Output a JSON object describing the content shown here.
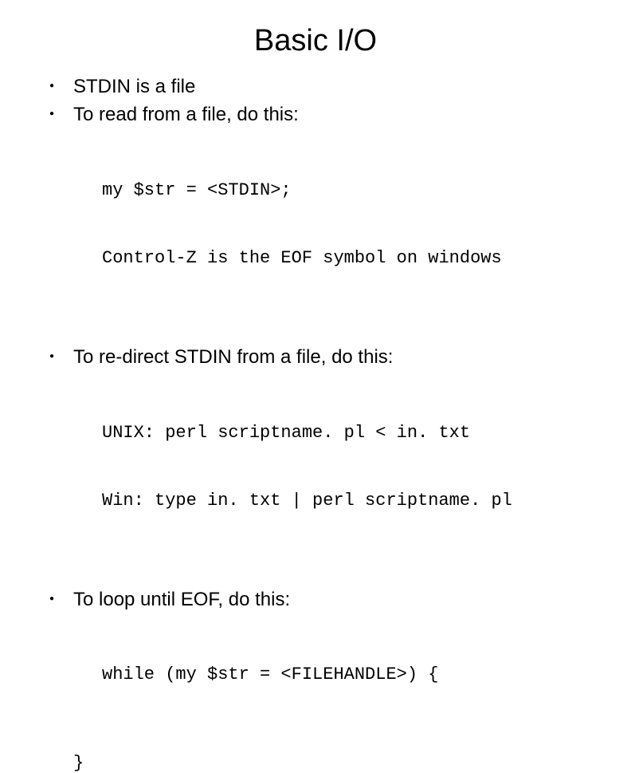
{
  "title": "Basic I/O",
  "bullets": {
    "b1": "STDIN is a file",
    "b2": "To read from a file, do this:",
    "b3": "To re-direct STDIN from a file, do this:",
    "b4": "To loop until EOF, do this:"
  },
  "code": {
    "c1a": "my $str = <STDIN>;",
    "c1b": "Control-Z is the EOF symbol on windows",
    "c2a": "UNIX: perl scriptname. pl < in. txt",
    "c2b": "Win: type in. txt | perl scriptname. pl",
    "c3a": "while (my $str = <FILEHANDLE>) {",
    "brace": "}"
  }
}
